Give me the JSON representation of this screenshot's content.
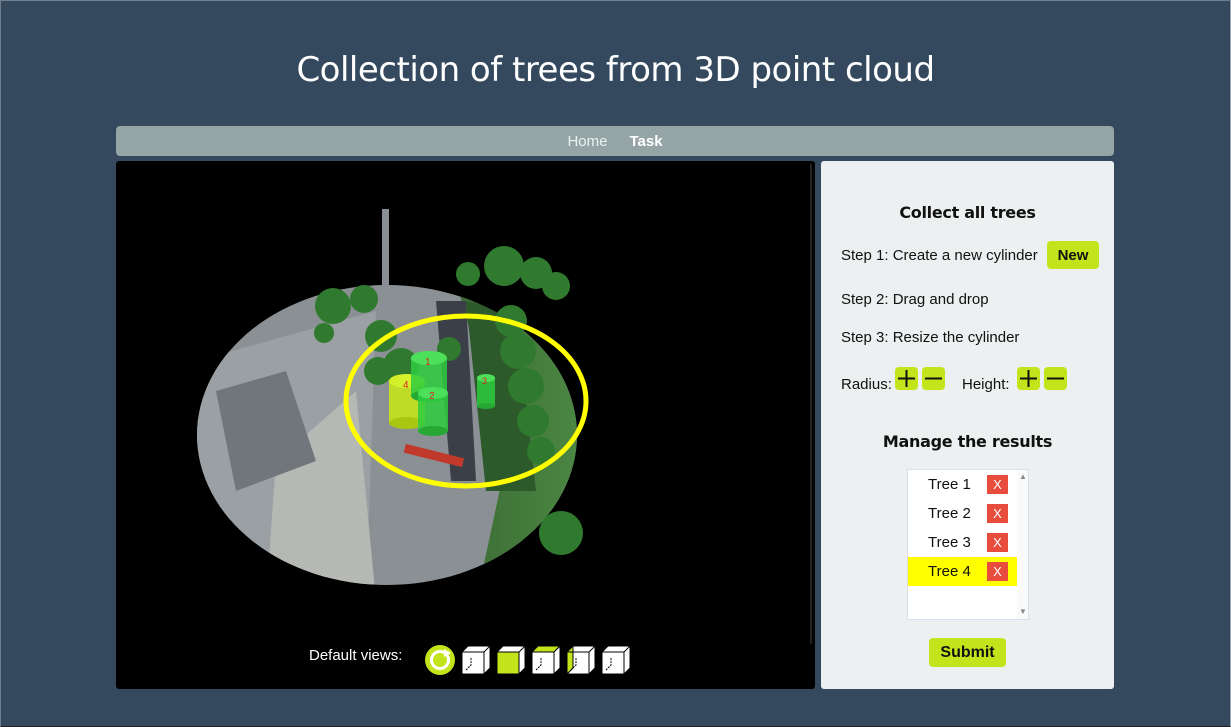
{
  "page": {
    "title": "Collection of trees from 3D point cloud"
  },
  "nav": {
    "items": [
      {
        "label": "Home",
        "active": false
      },
      {
        "label": "Task",
        "active": true
      }
    ]
  },
  "viewer": {
    "default_views_label": "Default views:",
    "views": [
      "reset-view-icon",
      "view-front-icon",
      "view-top-icon",
      "view-side-icon",
      "view-iso-icon",
      "view-back-icon"
    ],
    "cylinder_labels": [
      "1",
      "2",
      "3",
      "4"
    ]
  },
  "panel": {
    "collect_title": "Collect all trees",
    "step1": "Step 1: Create a new cylinder",
    "new_label": "New",
    "step2": "Step 2: Drag and drop",
    "step3": "Step 3: Resize the cylinder",
    "radius_label": "Radius:",
    "height_label": "Height:",
    "manage_title": "Manage the results",
    "trees": [
      {
        "label": "Tree 1",
        "delete_label": "X",
        "selected": false
      },
      {
        "label": "Tree 2",
        "delete_label": "X",
        "selected": false
      },
      {
        "label": "Tree 3",
        "delete_label": "X",
        "selected": false
      },
      {
        "label": "Tree 4",
        "delete_label": "X",
        "selected": true
      }
    ],
    "submit_label": "Submit"
  },
  "colors": {
    "background": "#34495e",
    "accent": "#c3e41b",
    "danger": "#e74c3c",
    "highlight": "#ffff00"
  }
}
